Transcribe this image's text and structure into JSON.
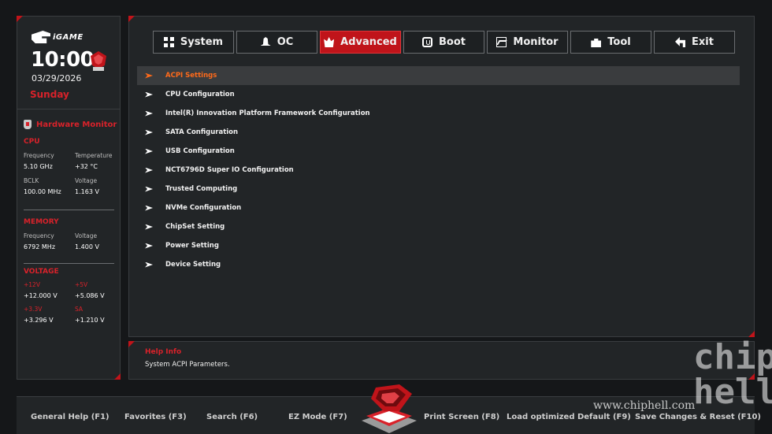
{
  "brand": {
    "name": "iGAME"
  },
  "clock": {
    "time": "10:00",
    "date": "03/29/2026",
    "day": "Sunday"
  },
  "hardware_monitor": {
    "title": "Hardware Monitor",
    "cpu": {
      "title": "CPU",
      "frequency_label": "Frequency",
      "frequency": "5.10 GHz",
      "temperature_label": "Temperature",
      "temperature": "+32 °C",
      "bclk_label": "BCLK",
      "bclk": "100.00 MHz",
      "voltage_label": "Voltage",
      "voltage": "1.163 V"
    },
    "memory": {
      "title": "MEMORY",
      "frequency_label": "Frequency",
      "frequency": "6792 MHz",
      "voltage_label": "Voltage",
      "voltage": "1.400 V"
    },
    "voltage": {
      "title": "VOLTAGE",
      "v12_label": "+12V",
      "v12": "+12.000 V",
      "v5_label": "+5V",
      "v5": "+5.086 V",
      "v33_label": "+3.3V",
      "v33": "+3.296 V",
      "sa_label": "SA",
      "sa": "+1.210 V"
    }
  },
  "tabs": [
    {
      "label": "System",
      "icon": "grid-icon"
    },
    {
      "label": "OC",
      "icon": "rocket-icon"
    },
    {
      "label": "Advanced",
      "icon": "crown-icon",
      "active": true
    },
    {
      "label": "Boot",
      "icon": "power-icon"
    },
    {
      "label": "Monitor",
      "icon": "chart-icon"
    },
    {
      "label": "Tool",
      "icon": "toolbox-icon"
    },
    {
      "label": "Exit",
      "icon": "return-icon"
    }
  ],
  "menu": [
    {
      "label": "ACPI Settings",
      "selected": true
    },
    {
      "label": "CPU Configuration"
    },
    {
      "label": "Intel(R) Innovation Platform Framework Configuration"
    },
    {
      "label": "SATA Configuration"
    },
    {
      "label": "USB Configuration"
    },
    {
      "label": "NCT6796D Super IO Configuration"
    },
    {
      "label": "Trusted Computing"
    },
    {
      "label": "NVMe Configuration"
    },
    {
      "label": "ChipSet Setting"
    },
    {
      "label": "Power Setting"
    },
    {
      "label": "Device Setting"
    }
  ],
  "help": {
    "title": "Help Info",
    "text": "System ACPI Parameters."
  },
  "footer": {
    "general_help": "General Help (F1)",
    "favorites": "Favorites (F3)",
    "search": "Search (F6)",
    "ez_mode": "EZ Mode (F7)",
    "print_screen": "Print Screen (F8)",
    "load_defaults": "Load optimized Default (F9)",
    "save_reset": "Save Changes & Reset (F10)"
  },
  "watermark": {
    "url": "www.chiphell.com",
    "logo": "chip hell"
  },
  "colors": {
    "accent": "#c0141a",
    "selected_text": "#ff6a1a",
    "panel": "#222527",
    "background": "#151719"
  }
}
